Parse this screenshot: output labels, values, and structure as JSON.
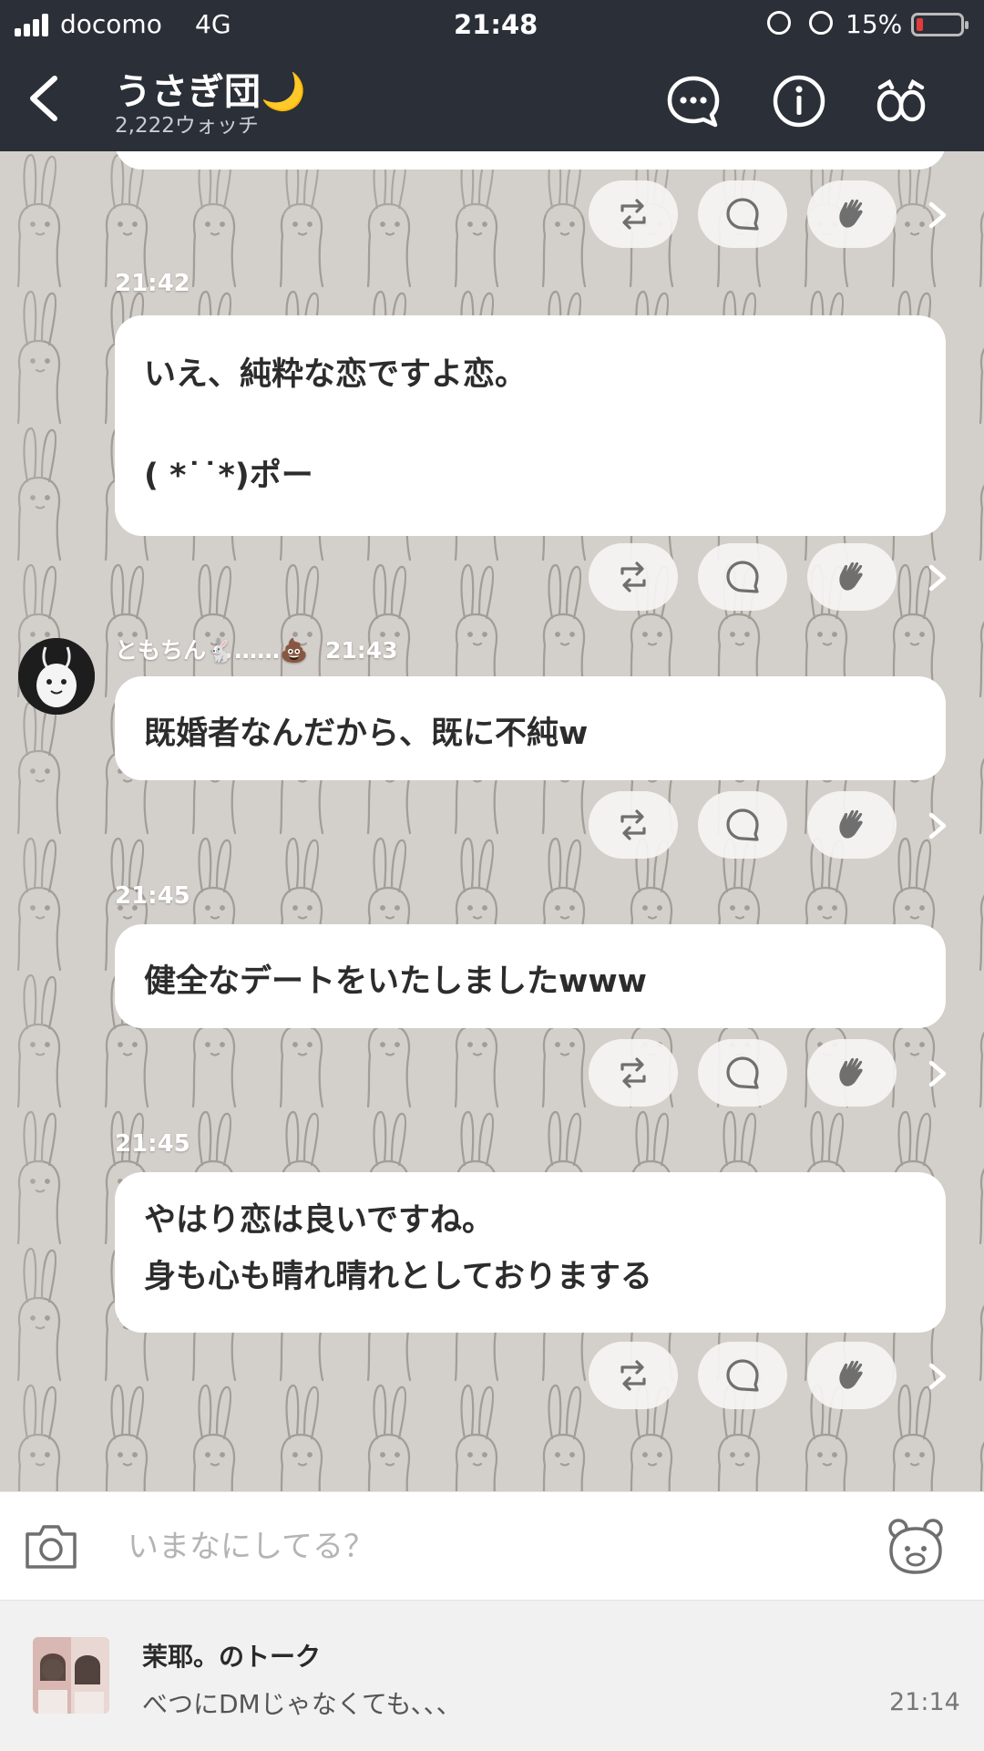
{
  "status_bar": {
    "carrier": "docomo",
    "network": "4G",
    "time": "21:48",
    "battery_percent": "15%",
    "battery_level": 0.15,
    "battery_color": "#e23b3b"
  },
  "header": {
    "title": "うさぎ団🌙",
    "subtitle": "2,222ウォッチ",
    "background": "#2b2f38"
  },
  "messages": [
    {
      "time": "",
      "lines": []
    },
    {
      "time": "21:42",
      "lines": [
        "いえ、純粋な恋ですよ恋。",
        "",
        "( *˙˙*)ポー"
      ]
    },
    {
      "sender": "ともちん🐇……💩",
      "time": "21:43",
      "lines": [
        "既婚者なんだから、既に不純w"
      ]
    },
    {
      "time": "21:45",
      "lines": [
        "健全なデートをいたしましたwww"
      ]
    },
    {
      "time": "21:45",
      "lines": [
        "やはり恋は良いですね。",
        "身も心も晴れ晴れとしておりまする"
      ]
    }
  ],
  "composer": {
    "placeholder": "いまなにしてる？"
  },
  "talk_preview": {
    "title": "茉耶。のトーク",
    "message": "べつにDMじゃなくても、、、",
    "time": "21:14"
  },
  "icons": [
    "back-arrow-icon",
    "chat-bubble-icon",
    "info-icon",
    "watch-eyes-icon",
    "repost-icon",
    "comment-icon",
    "clap-icon",
    "chevron-right-icon",
    "camera-icon",
    "sticker-bear-icon"
  ]
}
